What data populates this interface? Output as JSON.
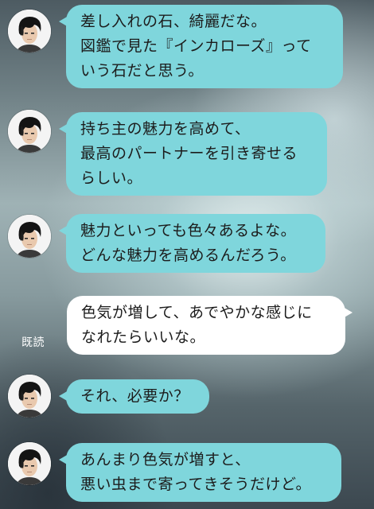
{
  "chat": {
    "read_label": "既読",
    "messages": [
      {
        "sender": "partner",
        "lines": [
          "差し入れの石、綺麗だな。",
          "図鑑で見た『インカローズ』って",
          "いう石だと思う。"
        ]
      },
      {
        "sender": "partner",
        "lines": [
          "持ち主の魅力を高めて、",
          "最高のパートナーを引き寄せる",
          "らしい。"
        ]
      },
      {
        "sender": "partner",
        "lines": [
          "魅力といっても色々あるよな。",
          "どんな魅力を高めるんだろう。"
        ]
      },
      {
        "sender": "me",
        "lines": [
          "色気が増して、あでやかな感じに",
          "なれたらいいな。"
        ]
      },
      {
        "sender": "partner",
        "lines": [
          "それ、必要か？"
        ]
      },
      {
        "sender": "partner",
        "lines": [
          "あんまり色気が増すと、",
          "悪い虫まで寄ってきそうだけど。"
        ]
      }
    ]
  },
  "colors": {
    "partner_bubble": "#7fd6dc",
    "my_bubble": "#ffffff",
    "text": "#1c1c1c"
  },
  "icons": {
    "avatar": "partner-avatar-icon"
  }
}
